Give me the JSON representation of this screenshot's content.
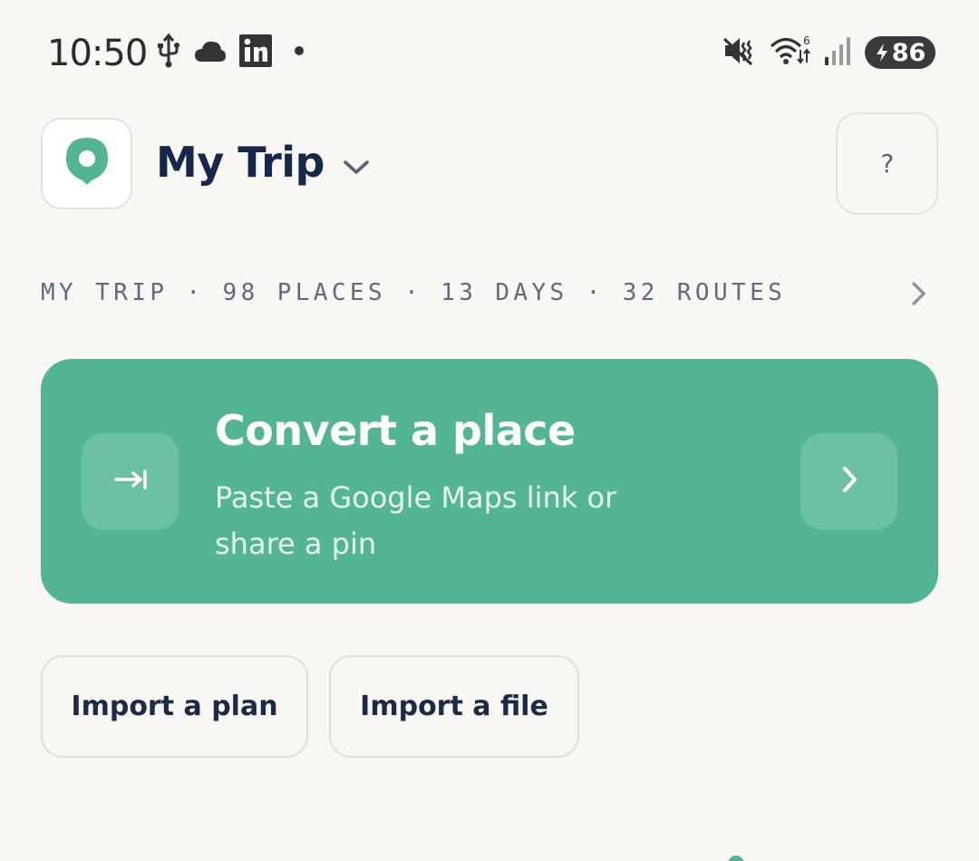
{
  "status_bar": {
    "time": "10:50",
    "battery": "86",
    "left_icons": [
      "usb-icon",
      "cloud-icon",
      "linkedin-icon",
      "dot-icon"
    ],
    "right_icons": [
      "vibrate-mute-icon",
      "wifi-icon",
      "signal-icon",
      "battery-icon"
    ]
  },
  "header": {
    "trip_name": "My Trip",
    "help_label": "?"
  },
  "summary": {
    "text": "MY TRIP · 98 PLACES · 13 DAYS · 32 ROUTES"
  },
  "convert_card": {
    "title": "Convert a place",
    "subtitle": "Paste a Google Maps link or share a pin"
  },
  "actions": {
    "import_plan": "Import a plan",
    "import_file": "Import a file"
  },
  "colors": {
    "accent": "#53b594",
    "background": "#f8f7f4",
    "title_text": "#17274a"
  }
}
